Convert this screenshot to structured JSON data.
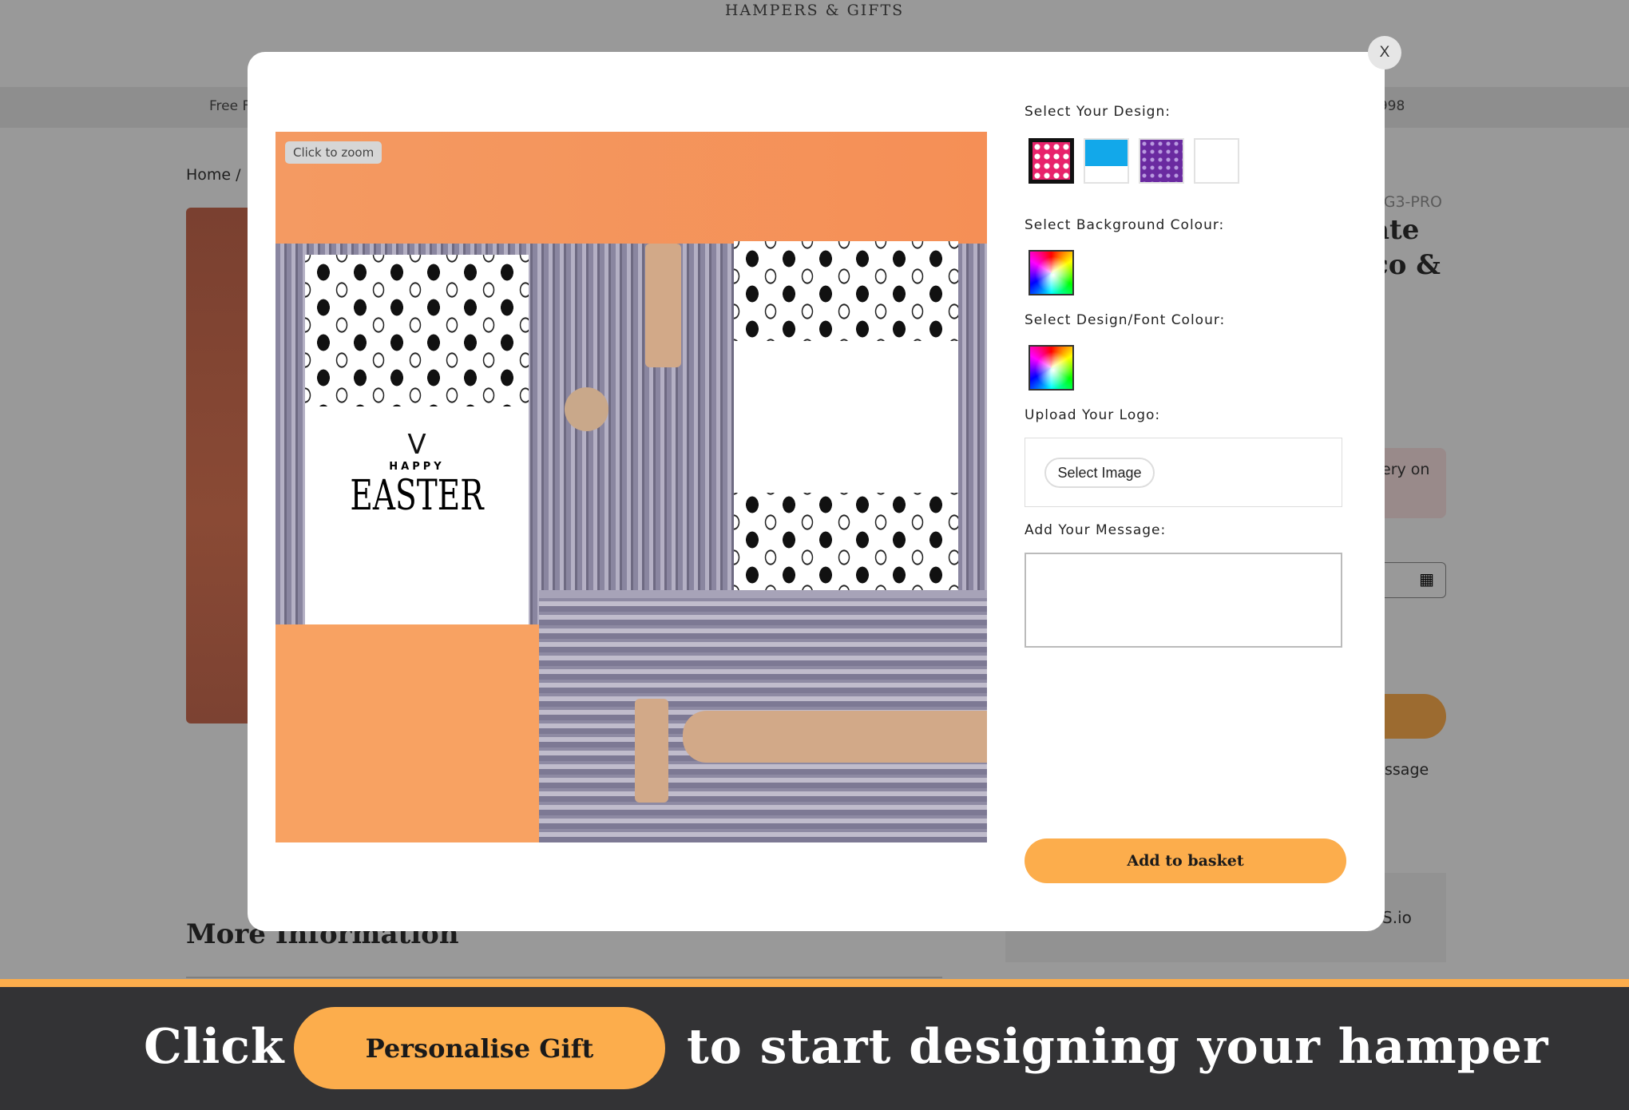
{
  "site": {
    "title": "HAMPERS & GIFTS",
    "topbar_left": "Free F",
    "topbar_right": "0998"
  },
  "background": {
    "breadcrumb": "Home / ",
    "sku": "GG3-PRO",
    "title_line1": "ate",
    "title_line2": "co &",
    "delivery_fragment": "ery on",
    "message_fragment": "ssage",
    "badge_fragment": "S.io",
    "more_info": "More Information"
  },
  "modal": {
    "close_label": "X",
    "zoom_hint": "Click to zoom",
    "card_text": {
      "small": "HAPPY",
      "large": "EASTER"
    },
    "design_label": "Select Your Design:",
    "designs": [
      {
        "name": "pink-eggs",
        "color": "#e8236b",
        "selected": true
      },
      {
        "name": "blue-bunnies",
        "color": "#12a8ea",
        "selected": false
      },
      {
        "name": "purple-floral",
        "color": "#6a2aa0",
        "selected": false
      },
      {
        "name": "blank",
        "color": "#ffffff",
        "selected": false
      }
    ],
    "bg_colour_label": "Select Background Colour:",
    "font_colour_label": "Select Design/Font Colour:",
    "logo_label": "Upload Your Logo:",
    "select_image": "Select Image",
    "message_label": "Add Your Message:",
    "message_value": "",
    "add_to_basket": "Add to basket"
  },
  "banner": {
    "left": "Click",
    "button": "Personalise Gift",
    "right": "to start designing your hamper"
  },
  "colors": {
    "accent": "#fcad4c",
    "banner_bg": "#333335",
    "overlay": "#999999"
  }
}
